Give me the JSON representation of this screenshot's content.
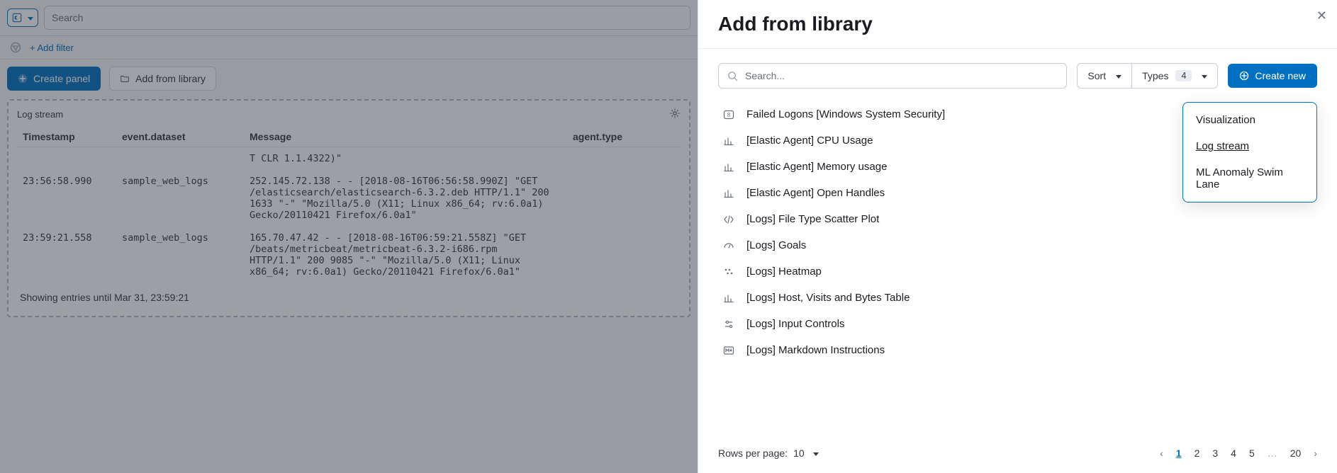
{
  "left": {
    "kql_icon": "kql",
    "search_placeholder": "Search",
    "add_filter": "+ Add filter",
    "create_panel": "Create panel",
    "add_from_lib": "Add from library",
    "panel_title": "Log stream",
    "columns": {
      "ts": "Timestamp",
      "ds": "event.dataset",
      "msg": "Message",
      "agent": "agent.type"
    },
    "partial_row_msg": "T CLR 1.1.4322)\"",
    "rows": [
      {
        "ts": "23:56:58.990",
        "ds": "sample_web_logs",
        "msg": "252.145.72.138 - - [2018-08-16T06:56:58.990Z] \"GET /elasticsearch/elasticsearch-6.3.2.deb HTTP/1.1\" 200 1633 \"-\" \"Mozilla/5.0 (X11; Linux x86_64; rv:6.0a1) Gecko/20110421 Firefox/6.0a1\""
      },
      {
        "ts": "23:59:21.558",
        "ds": "sample_web_logs",
        "msg": "165.70.47.42 - - [2018-08-16T06:59:21.558Z] \"GET /beats/metricbeat/metricbeat-6.3.2-i686.rpm HTTP/1.1\" 200 9085 \"-\" \"Mozilla/5.0 (X11; Linux x86_64; rv:6.0a1) Gecko/20110421 Firefox/6.0a1\""
      }
    ],
    "footer": "Showing entries until Mar 31, 23:59:21"
  },
  "flyout": {
    "title": "Add from library",
    "search_placeholder": "Search...",
    "sort_label": "Sort",
    "types_label": "Types",
    "types_count": "4",
    "create_label": "Create new",
    "items": [
      {
        "icon": "num",
        "label": "Failed Logons [Windows System Security]"
      },
      {
        "icon": "bar",
        "label": "[Elastic Agent] CPU Usage"
      },
      {
        "icon": "bar",
        "label": "[Elastic Agent] Memory usage"
      },
      {
        "icon": "bar",
        "label": "[Elastic Agent] Open Handles"
      },
      {
        "icon": "code",
        "label": "[Logs] File Type Scatter Plot"
      },
      {
        "icon": "gauge",
        "label": "[Logs] Goals"
      },
      {
        "icon": "heat",
        "label": "[Logs] Heatmap"
      },
      {
        "icon": "bar",
        "label": "[Logs] Host, Visits and Bytes Table"
      },
      {
        "icon": "ctrl",
        "label": "[Logs] Input Controls"
      },
      {
        "icon": "md",
        "label": "[Logs] Markdown Instructions"
      }
    ],
    "popover": {
      "items": [
        "Visualization",
        "Log stream",
        "ML Anomaly Swim Lane"
      ],
      "selected": "Log stream"
    },
    "rows_per_page_label": "Rows per page:",
    "rows_per_page_value": "10",
    "pages": [
      "1",
      "2",
      "3",
      "4",
      "5",
      "…",
      "20"
    ],
    "active_page": "1"
  }
}
